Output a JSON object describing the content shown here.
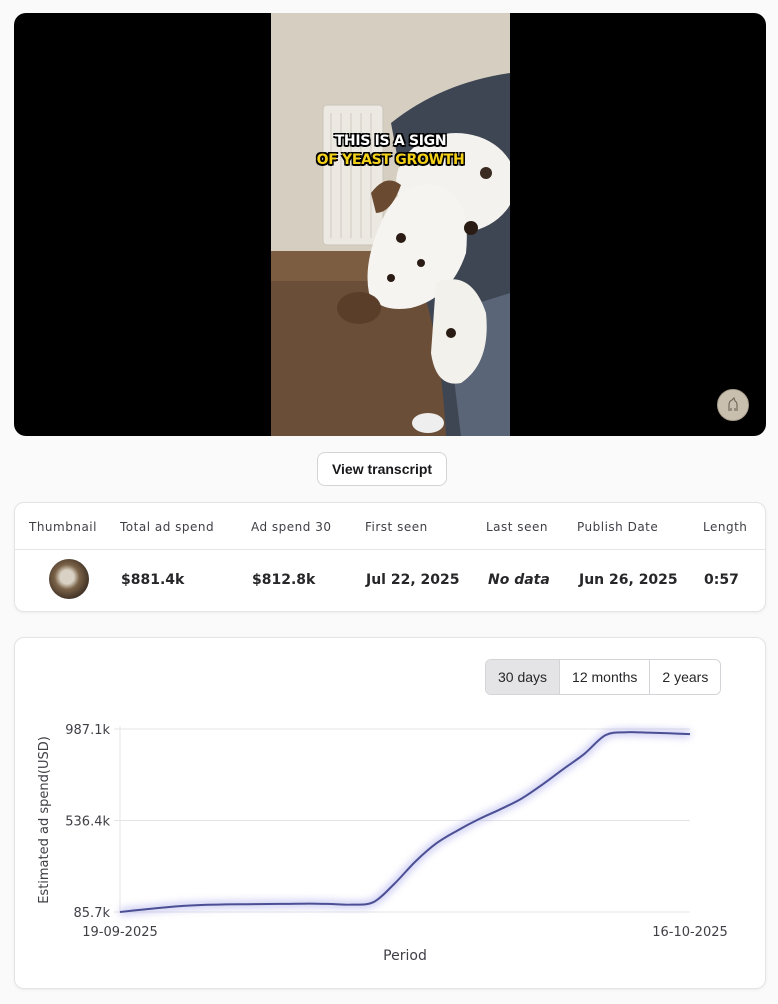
{
  "video": {
    "caption_line1": "THIS IS A SIGN",
    "caption_line2": "OF YEAST GROWTH",
    "brand_icon": "dog-avatar-icon"
  },
  "actions": {
    "view_transcript_label": "View transcript"
  },
  "stats": {
    "headers": [
      "Thumbnail",
      "Total ad spend",
      "Ad spend 30",
      "First seen",
      "Last seen",
      "Publish Date",
      "Length"
    ],
    "row": {
      "total_ad_spend": "$881.4k",
      "ad_spend_30": "$812.8k",
      "first_seen": "Jul 22, 2025",
      "last_seen": "No data",
      "publish_date": "Jun 26, 2025",
      "length": "0:57"
    }
  },
  "range_tabs": {
    "options": [
      "30 days",
      "12 months",
      "2 years"
    ],
    "selected": "30 days"
  },
  "colors": {
    "line": "#4b4f93",
    "glow": "#8f8fe6",
    "active_tab": "#e4e4e7"
  },
  "chart_data": {
    "type": "line",
    "xlabel": "Period",
    "ylabel": "Estimated ad spend(USD)",
    "x_tick_labels": [
      "19-09-2025",
      "16-10-2025"
    ],
    "y_tick_labels": [
      "987.1k",
      "536.4k",
      "85.7k"
    ],
    "ylim": [
      85.7,
      987.1
    ],
    "grid": "horizontal",
    "series": [
      {
        "x": [
          "19-09-2025",
          "20-09-2025",
          "21-09-2025",
          "22-09-2025",
          "23-09-2025",
          "24-09-2025",
          "25-09-2025",
          "26-09-2025",
          "27-09-2025",
          "28-09-2025",
          "29-09-2025",
          "30-09-2025",
          "01-10-2025",
          "02-10-2025",
          "03-10-2025",
          "04-10-2025",
          "05-10-2025",
          "06-10-2025",
          "07-10-2025",
          "08-10-2025",
          "09-10-2025",
          "10-10-2025",
          "11-10-2025",
          "12-10-2025",
          "13-10-2025",
          "14-10-2025",
          "15-10-2025",
          "16-10-2025"
        ],
        "values": [
          85.7,
          97,
          107,
          116,
          121,
          123,
          124,
          125,
          126,
          127,
          125,
          122,
          134,
          225,
          335,
          425,
          488,
          543,
          591,
          643,
          713,
          790,
          865,
          957,
          971,
          969,
          966,
          962
        ]
      }
    ]
  }
}
